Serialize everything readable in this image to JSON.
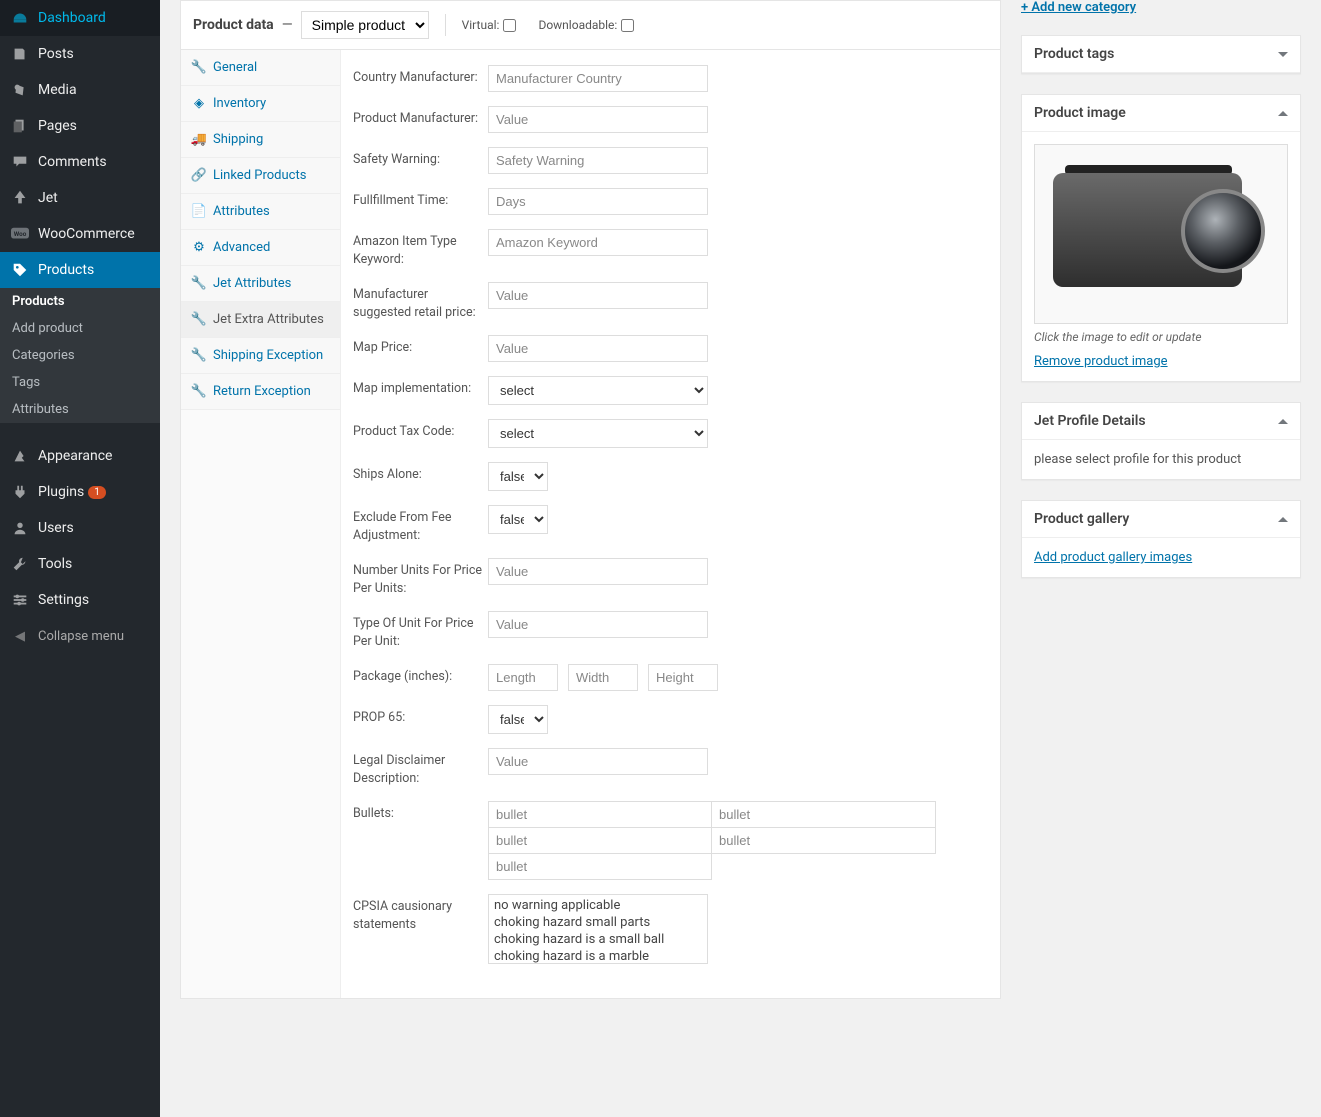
{
  "adminmenu": [
    {
      "icon": "dashboard",
      "label": "Dashboard"
    },
    {
      "icon": "posts",
      "label": "Posts"
    },
    {
      "icon": "media",
      "label": "Media"
    },
    {
      "icon": "pages",
      "label": "Pages"
    },
    {
      "icon": "comments",
      "label": "Comments"
    },
    {
      "icon": "jet",
      "label": "Jet"
    },
    {
      "icon": "woo",
      "label": "WooCommerce"
    },
    {
      "icon": "products",
      "label": "Products",
      "current": true,
      "submenu": [
        "Products",
        "Add product",
        "Categories",
        "Tags",
        "Attributes"
      ]
    },
    {
      "icon": "appearance",
      "label": "Appearance"
    },
    {
      "icon": "plugins",
      "label": "Plugins",
      "badge": "1"
    },
    {
      "icon": "users",
      "label": "Users"
    },
    {
      "icon": "tools",
      "label": "Tools"
    },
    {
      "icon": "settings",
      "label": "Settings"
    }
  ],
  "collapse_label": "Collapse menu",
  "product_data": {
    "title": "Product data",
    "dash": " — ",
    "type_selected": "Simple product",
    "virtual_label": "Virtual:",
    "downloadable_label": "Downloadable:"
  },
  "tabs": [
    {
      "icon": "wrench",
      "label": "General"
    },
    {
      "icon": "list",
      "label": "Inventory"
    },
    {
      "icon": "truck",
      "label": "Shipping"
    },
    {
      "icon": "link",
      "label": "Linked Products"
    },
    {
      "icon": "note",
      "label": "Attributes"
    },
    {
      "icon": "gear",
      "label": "Advanced"
    },
    {
      "icon": "wrench2",
      "label": "Jet Attributes"
    },
    {
      "icon": "wrench2",
      "label": "Jet Extra Attributes",
      "active": true
    },
    {
      "icon": "wrench2",
      "label": "Shipping Exception"
    },
    {
      "icon": "wrench2",
      "label": "Return Exception"
    }
  ],
  "fields": {
    "country_manufacturer": {
      "label": "Country Manufacturer:",
      "placeholder": "Manufacturer Country"
    },
    "product_manufacturer": {
      "label": "Product Manufacturer:",
      "placeholder": "Value"
    },
    "safety_warning": {
      "label": "Safety Warning:",
      "placeholder": "Safety Warning"
    },
    "fulfillment_time": {
      "label": "Fullfillment Time:",
      "placeholder": "Days"
    },
    "amazon_keyword": {
      "label": "Amazon Item Type Keyword:",
      "placeholder": "Amazon Keyword"
    },
    "msrp": {
      "label": "Manufacturer suggested retail price:",
      "placeholder": "Value"
    },
    "map_price": {
      "label": "Map Price:",
      "placeholder": "Value"
    },
    "map_impl": {
      "label": "Map implementation:",
      "selected": "select"
    },
    "tax_code": {
      "label": "Product Tax Code:",
      "selected": "select"
    },
    "ships_alone": {
      "label": "Ships Alone:",
      "selected": "false"
    },
    "exclude_fee": {
      "label": "Exclude From Fee Adjustment:",
      "selected": "false"
    },
    "num_units": {
      "label": "Number Units For Price Per Units:",
      "placeholder": "Value"
    },
    "type_unit": {
      "label": "Type Of Unit For Price Per Unit:",
      "placeholder": "Value"
    },
    "package": {
      "label": "Package (inches):",
      "l": "Length",
      "w": "Width",
      "h": "Height"
    },
    "prop65": {
      "label": "PROP 65:",
      "selected": "false"
    },
    "legal": {
      "label": "Legal Disclaimer Description:",
      "placeholder": "Value"
    },
    "bullets": {
      "label": "Bullets:",
      "placeholder": "bullet"
    },
    "cpsia": {
      "label": "CPSIA causionary statements",
      "options": [
        "no warning applicable",
        "choking hazard small parts",
        "choking hazard is a small ball",
        "choking hazard is a marble"
      ]
    }
  },
  "side": {
    "add_category": "+ Add new category",
    "product_tags": "Product tags",
    "product_image": "Product image",
    "image_caption": "Click the image to edit or update",
    "remove_image": "Remove product image",
    "jet_profile": "Jet Profile Details",
    "jet_profile_text": "please select profile for this product",
    "product_gallery": "Product gallery",
    "add_gallery": "Add product gallery images"
  }
}
